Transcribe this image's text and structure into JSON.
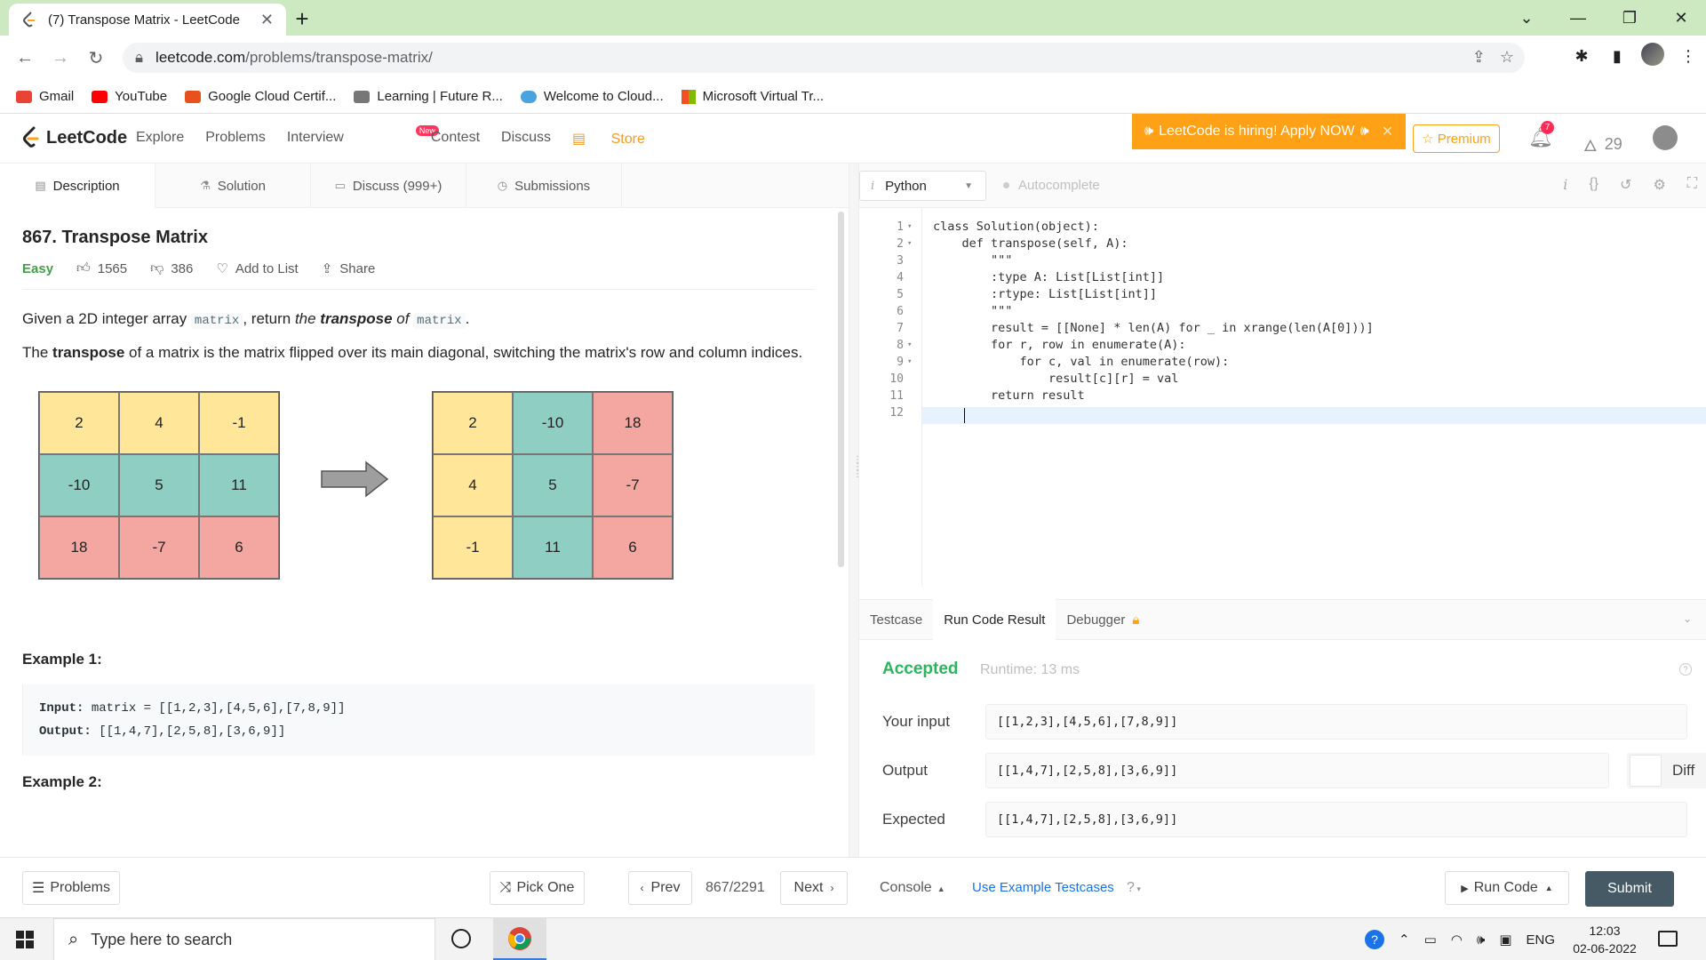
{
  "browser": {
    "tab_title": "(7) Transpose Matrix - LeetCode",
    "url_host": "leetcode.com",
    "url_path": "/problems/transpose-matrix/",
    "bookmarks": [
      {
        "label": "Gmail",
        "color": "#ea4335"
      },
      {
        "label": "YouTube",
        "color": "#ff0000"
      },
      {
        "label": "Google Cloud Certif...",
        "color": "#e8511e"
      },
      {
        "label": "Learning | Future R...",
        "color": "#777777"
      },
      {
        "label": "Welcome to Cloud...",
        "color": "#4aa3df"
      },
      {
        "label": "Microsoft Virtual Tr...",
        "color": "#f25022"
      }
    ]
  },
  "nav": {
    "logo": "LeetCode",
    "links": [
      "Explore",
      "Problems",
      "Interview",
      "Contest",
      "Discuss"
    ],
    "new_badge": "New",
    "store": "Store",
    "hiring": "LeetCode is hiring! Apply NOW",
    "premium": "Premium",
    "notifications": "7",
    "streak": "29"
  },
  "desc_tabs": [
    "Description",
    "Solution",
    "Discuss (999+)",
    "Submissions"
  ],
  "problem": {
    "title": "867. Transpose Matrix",
    "difficulty": "Easy",
    "likes": "1565",
    "dislikes": "386",
    "add_to_list": "Add to List",
    "share": "Share",
    "p1_a": "Given a 2D integer array ",
    "p1_code1": "matrix",
    "p1_b": ", return ",
    "p1_c": "the ",
    "p1_d": "transpose",
    "p1_e": " of ",
    "p1_code2": "matrix",
    "p1_f": ".",
    "p2_a": "The ",
    "p2_b": "transpose",
    "p2_c": " of a matrix is the matrix flipped over its main diagonal, switching the matrix's row and column indices.",
    "matrix_before": [
      [
        "2",
        "4",
        "-1"
      ],
      [
        "-10",
        "5",
        "11"
      ],
      [
        "18",
        "-7",
        "6"
      ]
    ],
    "matrix_after": [
      [
        "2",
        "-10",
        "18"
      ],
      [
        "4",
        "5",
        "-7"
      ],
      [
        "-1",
        "11",
        "6"
      ]
    ],
    "example1_title": "Example 1:",
    "example1_input_label": "Input:",
    "example1_input": " matrix = [[1,2,3],[4,5,6],[7,8,9]]",
    "example1_output_label": "Output:",
    "example1_output": " [[1,4,7],[2,5,8],[3,6,9]]",
    "example2_title": "Example 2:"
  },
  "editor": {
    "language": "Python",
    "autocomplete": "Autocomplete",
    "lines": [
      "class Solution(object):",
      "    def transpose(self, A):",
      "        \"\"\"",
      "        :type A: List[List[int]]",
      "        :rtype: List[List[int]]",
      "        \"\"\"",
      "        result = [[None] * len(A) for _ in xrange(len(A[0]))]",
      "        for r, row in enumerate(A):",
      "            for c, val in enumerate(row):",
      "                result[c][r] = val",
      "        return result",
      ""
    ]
  },
  "result_tabs": [
    "Testcase",
    "Run Code Result",
    "Debugger"
  ],
  "result": {
    "status": "Accepted",
    "runtime": "Runtime: 13 ms",
    "input_label": "Your input",
    "input": "[[1,2,3],[4,5,6],[7,8,9]]",
    "output_label": "Output",
    "output": "[[1,4,7],[2,5,8],[3,6,9]]",
    "diff": "Diff",
    "expected_label": "Expected",
    "expected": "[[1,4,7],[2,5,8],[3,6,9]]"
  },
  "footer": {
    "problems": "Problems",
    "pick_one": "Pick One",
    "prev": "Prev",
    "page": "867/2291",
    "next": "Next",
    "console": "Console",
    "use_example": "Use Example Testcases",
    "run_code": "Run Code",
    "submit": "Submit"
  },
  "taskbar": {
    "search_placeholder": "Type here to search",
    "language": "ENG",
    "time": "12:03",
    "date": "02-06-2022"
  }
}
